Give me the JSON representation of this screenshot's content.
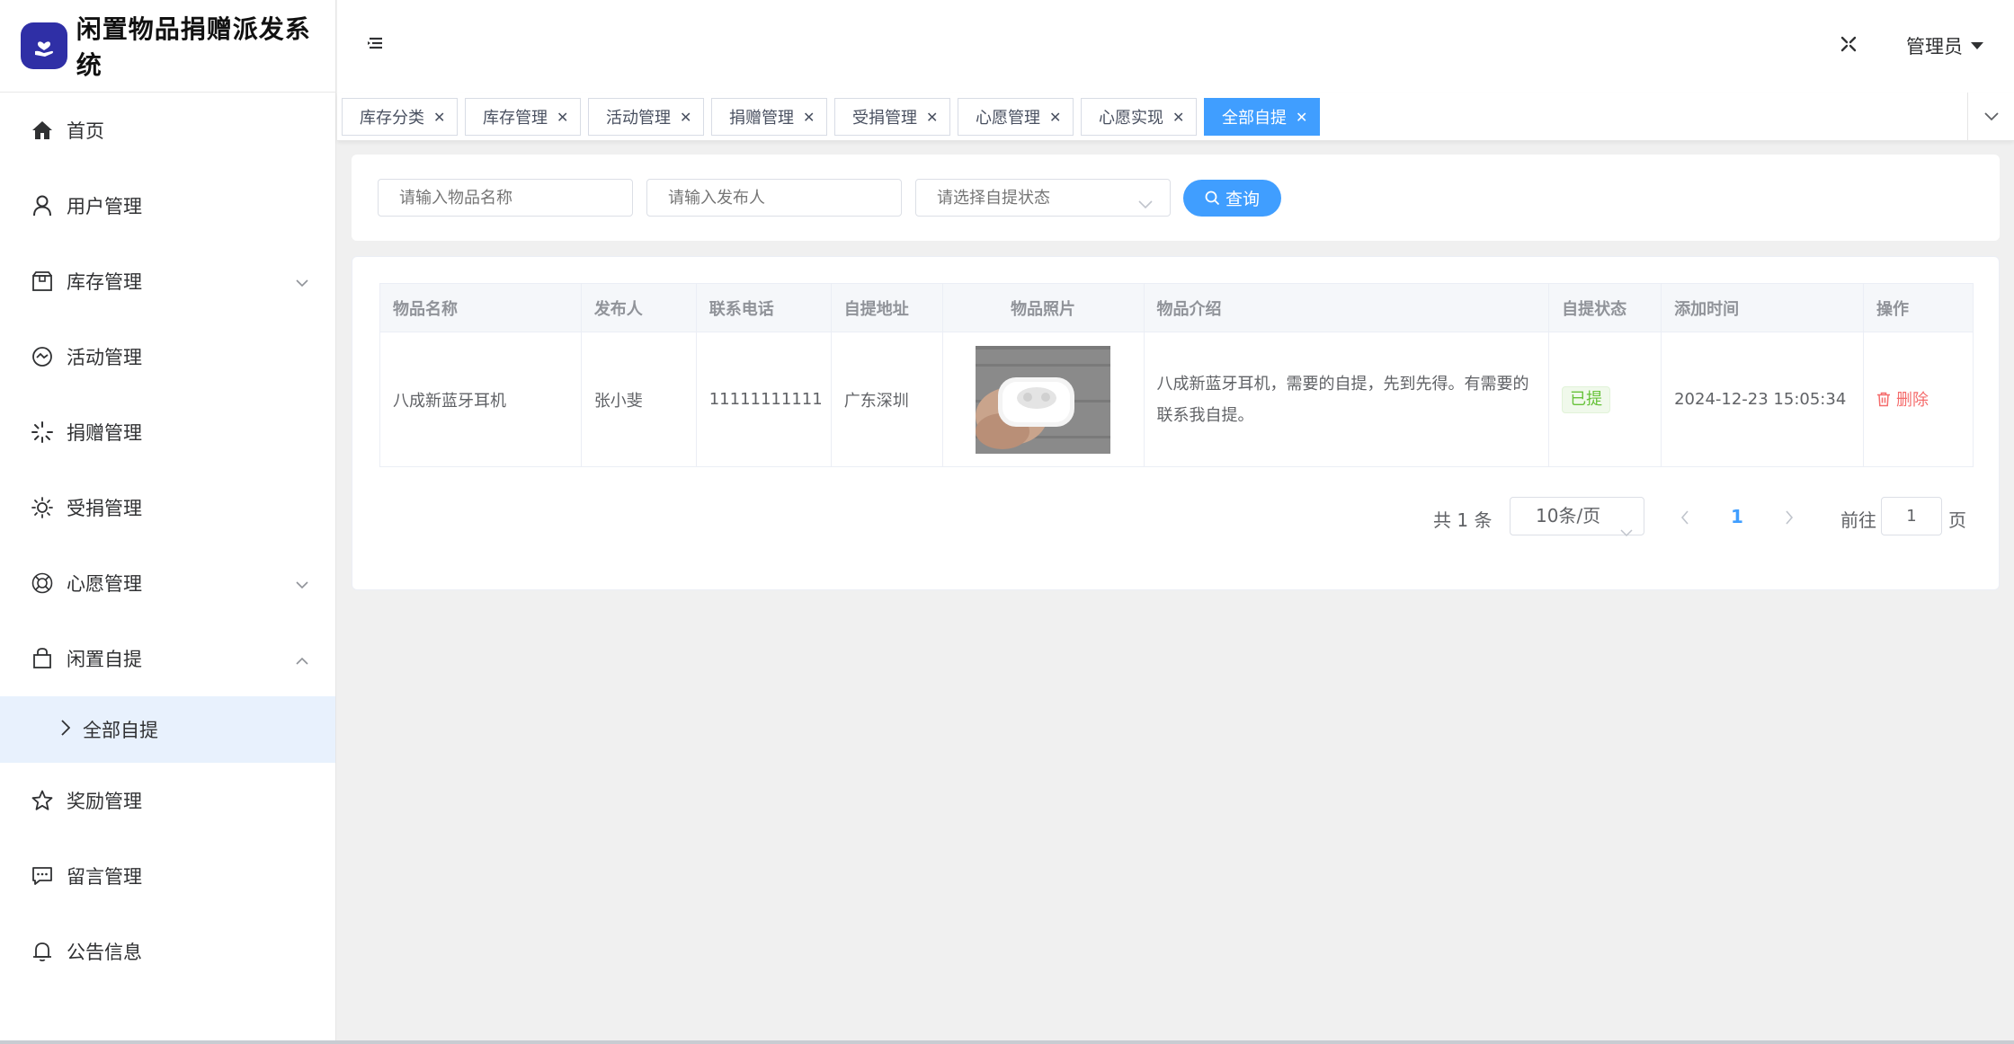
{
  "app": {
    "title": "闲置物品捐赠派发系统"
  },
  "sidebar": {
    "items": [
      {
        "label": "首页",
        "icon": "home-icon"
      },
      {
        "label": "用户管理",
        "icon": "user-icon"
      },
      {
        "label": "库存管理",
        "icon": "box-icon",
        "arrow": "down"
      },
      {
        "label": "活动管理",
        "icon": "activity-icon"
      },
      {
        "label": "捐赠管理",
        "icon": "loading-icon"
      },
      {
        "label": "受捐管理",
        "icon": "sun-icon"
      },
      {
        "label": "心愿管理",
        "icon": "help-icon",
        "arrow": "down"
      },
      {
        "label": "闲置自提",
        "icon": "bag-icon",
        "arrow": "up"
      }
    ],
    "submenu": {
      "label": "全部自提"
    },
    "items_after": [
      {
        "label": "奖励管理",
        "icon": "star-icon"
      },
      {
        "label": "留言管理",
        "icon": "chat-icon"
      },
      {
        "label": "公告信息",
        "icon": "bell-icon"
      }
    ]
  },
  "header": {
    "user": "管理员"
  },
  "tabs": [
    {
      "label": "库存分类"
    },
    {
      "label": "库存管理"
    },
    {
      "label": "活动管理"
    },
    {
      "label": "捐赠管理"
    },
    {
      "label": "受捐管理"
    },
    {
      "label": "心愿管理"
    },
    {
      "label": "心愿实现"
    },
    {
      "label": "全部自提",
      "active": true
    }
  ],
  "search": {
    "name_placeholder": "请输入物品名称",
    "publisher_placeholder": "请输入发布人",
    "status_placeholder": "请选择自提状态",
    "button_label": "查询"
  },
  "table": {
    "headers": [
      "物品名称",
      "发布人",
      "联系电话",
      "自提地址",
      "物品照片",
      "物品介绍",
      "自提状态",
      "添加时间",
      "操作"
    ],
    "rows": [
      {
        "name": "八成新蓝牙耳机",
        "publisher": "张小斐",
        "phone": "11111111111",
        "address": "广东深圳",
        "intro": "八成新蓝牙耳机，需要的自提，先到先得。有需要的联系我自提。",
        "status": "已提",
        "time": "2024-12-23 15:05:34",
        "action": "删除"
      }
    ]
  },
  "pagination": {
    "total": "共 1 条",
    "page_size": "10条/页",
    "current": "1",
    "goto_label": "前往",
    "goto_value": "1",
    "page_label": "页"
  },
  "colors": {
    "primary": "#409eff",
    "logo_bg": "#2f2fa6",
    "success": "#67c23a",
    "danger": "#f56c6c"
  }
}
